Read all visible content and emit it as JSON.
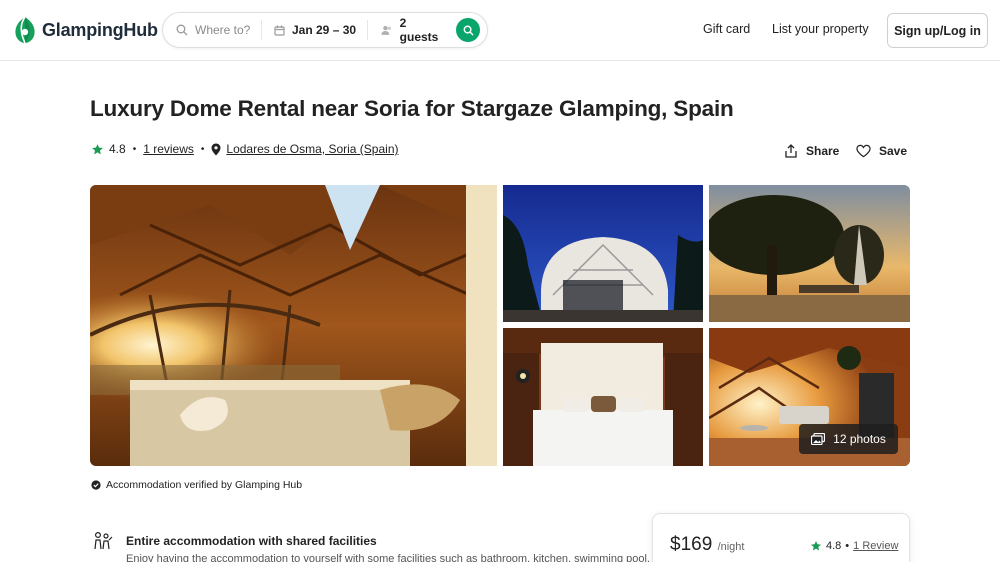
{
  "header": {
    "logo_text": "GlampingHub",
    "logo_icon": "leaf-logo-icon",
    "search": {
      "where_placeholder": "Where to?",
      "dates": "Jan 29 – 30",
      "guests": "2 guests"
    },
    "nav": {
      "gift_card": "Gift card",
      "list_property": "List your property",
      "signup": "Sign up/Log in"
    }
  },
  "listing": {
    "title": "Luxury Dome Rental near Soria for Stargaze Glamping, Spain",
    "rating": "4.8",
    "reviews_link": "1 reviews",
    "location": "Lodares de Osma, Soria (Spain)",
    "share_label": "Share",
    "save_label": "Save",
    "photos_button": "12 photos",
    "verified_text": "Accommodation verified by Glamping Hub"
  },
  "feature": {
    "title": "Entire accommodation with shared facilities",
    "desc": "Enjoy having the accommodation to yourself with some facilities such as bathroom, kitchen, swimming pool,"
  },
  "booking": {
    "price": "$169",
    "per": "/night",
    "rating": "4.8",
    "reviews_link": "1 Review"
  },
  "colors": {
    "accent_green": "#0aa56b",
    "star_green": "#1a9c55",
    "text": "#222222"
  }
}
